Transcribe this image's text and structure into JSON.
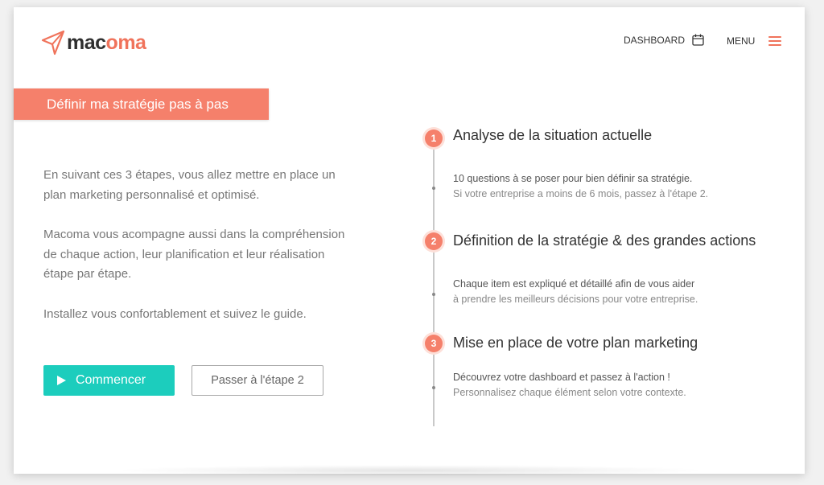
{
  "header": {
    "logo": {
      "part1": "mac",
      "part2": "oma"
    },
    "dashboard_label": "DASHBOARD",
    "menu_label": "MENU"
  },
  "page": {
    "title": "Définir ma stratégie pas à pas",
    "intro": [
      "En suivant ces 3 étapes, vous allez mettre en place un plan marketing personnalisé et optimisé.",
      "Macoma vous acompagne aussi dans la compréhension de chaque action, leur planification et leur réalisation étape par étape.",
      "Installez vous confortablement et suivez le guide."
    ],
    "start_button": "Commencer",
    "skip_button": "Passer à l'étape 2"
  },
  "steps": [
    {
      "number": "1",
      "title": "Analyse de la situation actuelle",
      "line1": "10 questions à se poser pour bien définir sa stratégie.",
      "line2": "Si votre entreprise a moins de 6 mois, passez à l'étape 2."
    },
    {
      "number": "2",
      "title": "Définition de la stratégie & des grandes actions",
      "line1": "Chaque item est expliqué et détaillé afin de vous aider",
      "line2": "à prendre les meilleurs décisions pour votre entreprise."
    },
    {
      "number": "3",
      "title": "Mise en place de votre plan marketing",
      "line1": "Découvrez votre dashboard et passez à l'action !",
      "line2": "Personnalisez chaque élément selon votre contexte."
    }
  ],
  "icons": {
    "logo": "paper-plane-icon",
    "dashboard": "calendar-icon",
    "menu": "hamburger-icon",
    "start": "play-icon"
  },
  "colors": {
    "accent": "#f5806b",
    "primary_button": "#1ccdbd",
    "text": "#333333",
    "muted": "#777777"
  }
}
